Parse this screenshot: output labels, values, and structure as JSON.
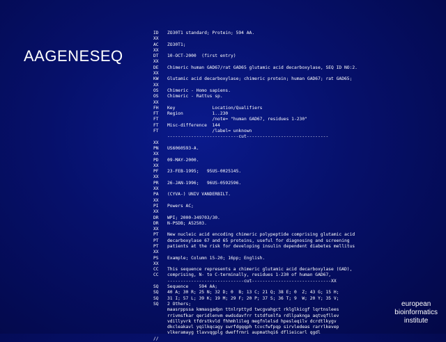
{
  "title": "AAGENESEQ",
  "lines": [
    {
      "code": "ID",
      "text": "ZO30T1 standard; Protein; 594 AA."
    },
    {
      "code": "XX",
      "text": ""
    },
    {
      "code": "AC",
      "text": "ZO30T1;"
    },
    {
      "code": "XX",
      "text": ""
    },
    {
      "code": "DT",
      "text": "10-OCT-2000  (first entry)"
    },
    {
      "code": "XX",
      "text": ""
    },
    {
      "code": "DE",
      "text": "Chimeric human GAD67/rat GAD65 glutamic acid decarboxylase, SEQ ID NO:2."
    },
    {
      "code": "XX",
      "text": ""
    },
    {
      "code": "KW",
      "text": "Glutamic acid decarboxylase; chimeric protein; human GAD67; rat GAD65;"
    },
    {
      "code": "XX",
      "text": ""
    },
    {
      "code": "OS",
      "text": "Chimeric - Homo sapiens."
    },
    {
      "code": "OS",
      "text": "Chimeric - Rattus sp."
    },
    {
      "code": "XX",
      "text": ""
    },
    {
      "code": "FH",
      "text": "Key              Location/Qualifiers"
    },
    {
      "code": "FT",
      "text": "Region           1..230"
    },
    {
      "code": "FT",
      "text": "                 /note= \"human GAD67, residues 1-230\""
    },
    {
      "code": "FT",
      "text": "Misc-difference  144"
    },
    {
      "code": "FT",
      "text": "                 /label= unknown"
    },
    {
      "code": "",
      "text": "---------------------------cut-------------------------------"
    },
    {
      "code": "XX",
      "text": ""
    },
    {
      "code": "PN",
      "text": "US6060593-A."
    },
    {
      "code": "XX",
      "text": ""
    },
    {
      "code": "PD",
      "text": "09-MAY-2000."
    },
    {
      "code": "XX",
      "text": ""
    },
    {
      "code": "PF",
      "text": "23-FEB-1995;   95US-0025145."
    },
    {
      "code": "XX",
      "text": ""
    },
    {
      "code": "PR",
      "text": "26-JAN-1996;   96US-0592596."
    },
    {
      "code": "XX",
      "text": ""
    },
    {
      "code": "PA",
      "text": "(CYVA-) UNIV VANDERBILT."
    },
    {
      "code": "XX",
      "text": ""
    },
    {
      "code": "PI",
      "text": "Powers AC;"
    },
    {
      "code": "XX",
      "text": ""
    },
    {
      "code": "DR",
      "text": "WPI; 2000-349703/30."
    },
    {
      "code": "DR",
      "text": "N-PSDB; A52503."
    },
    {
      "code": "XX",
      "text": ""
    },
    {
      "code": "PT",
      "text": "New nucleic acid encoding chimeric polypeptide comprising glutamic acid"
    },
    {
      "code": "PT",
      "text": "decarboxylase 67 and 65 proteins, useful for diagnosing and screening"
    },
    {
      "code": "PT",
      "text": "patients at the risk for developing insulin dependent diabetes mellitus"
    },
    {
      "code": "XX",
      "text": ""
    },
    {
      "code": "PS",
      "text": "Example; Column 15-20; 16pp; English."
    },
    {
      "code": "XX",
      "text": ""
    },
    {
      "code": "CC",
      "text": "This sequence represents a chimeric glutamic acid decarboxylase (GAD),"
    },
    {
      "code": "CC",
      "text": "comprising, N- to C-terminally, residues 1-230 of human GAD67,"
    },
    {
      "code": "",
      "text": "-----------------------------cut------------------------------XX"
    },
    {
      "code": "SQ",
      "text": "Sequence    594 AA;"
    },
    {
      "code": "SQ",
      "text": "40 A; 30 R; 25 N; 32 D; 0  B; 13 C; 21 Q; 38 E; 0  Z; 43 G; 15 H;"
    },
    {
      "code": "SQ",
      "text": "31 I; 57 L; 39 K; 19 M; 29 F; 20 P; 37 S; 36 T; 9  W; 20 Y; 35 V;"
    },
    {
      "code": "SQ",
      "text": "2 Others;"
    },
    {
      "code": "",
      "text": "maasrppssa kmmasgadpn ttnlrpttyd twcgvahgct rklglkicgf lqrtnslees"
    },
    {
      "code": "",
      "text": "rrivmsfkar qeridlenvm ewdsdavfrr tstdfsmlfa rdllpaknga aqtvqfllev"
    },
    {
      "code": "",
      "text": "vdillyvrk tfdrstkvld fhhmhlileg megfnlelsd hpesleqilv dcrdtlkygv"
    },
    {
      "code": "",
      "text": "dkcleakavl yqilkqcagy swrfdgqqph tcvcfwfpqp sirvledeas rarrlkevep"
    },
    {
      "code": "",
      "text": "vlkeramayg tlavvqgplg dweffrmri aupmathqi6 dflieicarl qgdl"
    },
    {
      "code": "//",
      "text": ""
    }
  ],
  "footer": {
    "line1": "european",
    "line2": "bioinformatics",
    "line3": "institute"
  }
}
